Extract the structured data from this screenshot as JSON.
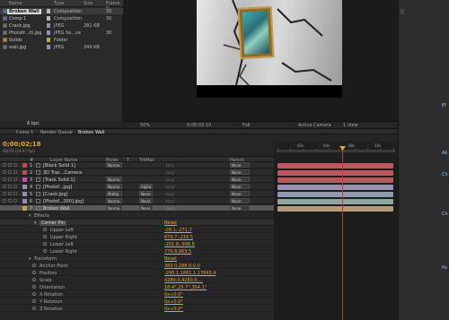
{
  "project": {
    "headers": [
      "Name",
      "Type",
      "Size",
      "Frame R..."
    ],
    "items": [
      {
        "name": "Broken Wall",
        "type": "Composition",
        "size": "",
        "frame": "30",
        "icon": "comp-icon",
        "label_color": "#b9b9b9"
      },
      {
        "name": "Comp 1",
        "type": "Composition",
        "size": "",
        "frame": "30",
        "icon": "comp-icon",
        "label_color": "#b9b9b9"
      },
      {
        "name": "Crack.jpg",
        "type": "JPEG",
        "size": "281 KB",
        "frame": "",
        "icon": "image-icon",
        "label_color": "#9a8ab4"
      },
      {
        "name": "Photofr...il).jpg",
        "type": "JPEG Se...ce",
        "size": "",
        "frame": "30",
        "icon": "image-icon",
        "label_color": "#9a8ab4"
      },
      {
        "name": "Solids",
        "type": "Folder",
        "size": "",
        "frame": "",
        "icon": "folder-icon",
        "label_color": "#c4a445"
      },
      {
        "name": "wall.jpg",
        "type": "JPEG",
        "size": "349 KB",
        "frame": "",
        "icon": "image-icon",
        "label_color": "#9a8ab4"
      }
    ],
    "bpc": "8 bpc"
  },
  "viewer": {
    "zoom": "50%",
    "timecode": "0;00;02;10",
    "resolution": "Full",
    "camera": "Active Camera",
    "views": "1 View"
  },
  "tabs": [
    {
      "label": "Comp 1",
      "active": false
    },
    {
      "label": "Render Queue",
      "active": false
    },
    {
      "label": "Broken Wall",
      "active": true
    }
  ],
  "timeline": {
    "timecode": "0;00;02;18",
    "fps_line": "00078 (29.97 fps)",
    "columns": [
      "#",
      "Layer Name",
      "Mode",
      "T",
      "TrkMat",
      "Parent"
    ],
    "ruler_ticks": [
      "02s",
      "04s",
      "08s",
      "10s"
    ],
    "layers": [
      {
        "num": "1",
        "name": "[Black Solid 1]",
        "mode": "Norma",
        "trkmat": "",
        "parent": "None",
        "label_color": "#c24a4a",
        "bar_color": "#b95a5e"
      },
      {
        "num": "2",
        "name": "3D Trac...Camera",
        "mode": "",
        "trkmat": "",
        "parent": "None",
        "label_color": "#c24a4a",
        "bar_color": "#b95a5e"
      },
      {
        "num": "3",
        "name": "[Track Solid 1]",
        "mode": "Norma",
        "trkmat": "",
        "parent": "None",
        "label_color": "#c94bbd",
        "bar_color": "#b95a5e"
      },
      {
        "num": "4",
        "name": "[Photof...jpg]",
        "mode": "Norma",
        "trkmat": "Alpha",
        "parent": "None",
        "label_color": "#9a8ab4",
        "bar_color": "#9a90b3"
      },
      {
        "num": "5",
        "name": "[Crack.jpg]",
        "mode": "Multip",
        "trkmat": "None",
        "parent": "None",
        "label_color": "#9a8ab4",
        "bar_color": "#8e9ab0"
      },
      {
        "num": "6",
        "name": "[Photof...200].jpg]",
        "mode": "Norma",
        "trkmat": "None",
        "parent": "None",
        "label_color": "#9a8ab4",
        "bar_color": "#8fa79e"
      },
      {
        "num": "7",
        "name": "Broken Wall",
        "mode": "Norma",
        "trkmat": "None",
        "parent": "None",
        "label_color": "#c4a445",
        "bar_color": "#b59c78"
      }
    ],
    "properties": [
      {
        "indent": 38,
        "name": "Effects",
        "value": "",
        "kind": "group"
      },
      {
        "indent": 44,
        "name": "Corner Pin",
        "value": "Reset",
        "kind": "effect"
      },
      {
        "indent": 56,
        "name": "Upper Left",
        "value": "-28.1,-271.7",
        "kind": "prop"
      },
      {
        "indent": 56,
        "name": "Upper Right",
        "value": "879.7,-216.5",
        "kind": "prop"
      },
      {
        "indent": 56,
        "name": "Lower Left",
        "value": "-201.8,-998.8",
        "kind": "prop"
      },
      {
        "indent": 56,
        "name": "Lower Right",
        "value": "770.8,963.5",
        "kind": "prop"
      },
      {
        "indent": 38,
        "name": "Transform",
        "value": "Reset",
        "kind": "group"
      },
      {
        "indent": 44,
        "name": "Anchor Point",
        "value": "360.0,288.0,0.0",
        "kind": "prop"
      },
      {
        "indent": 44,
        "name": "Position",
        "value": "-295.1,1861.1,17843.4",
        "kind": "prop"
      },
      {
        "indent": 44,
        "name": "Scale",
        "value": "4280.0,4280.0,...",
        "kind": "prop"
      },
      {
        "indent": 44,
        "name": "Orientation",
        "value": "18.4°,25.7°,354.1°",
        "kind": "prop"
      },
      {
        "indent": 44,
        "name": "X Rotation",
        "value": "0x+0.0°",
        "kind": "prop"
      },
      {
        "indent": 44,
        "name": "Y Rotation",
        "value": "0x+0.0°",
        "kind": "prop"
      },
      {
        "indent": 44,
        "name": "Z Rotation",
        "value": "0x+0.0°",
        "kind": "prop"
      }
    ]
  },
  "tools": {
    "labels": [
      "Ef",
      "Ali",
      "Ch",
      "Ch",
      "Pa"
    ]
  }
}
